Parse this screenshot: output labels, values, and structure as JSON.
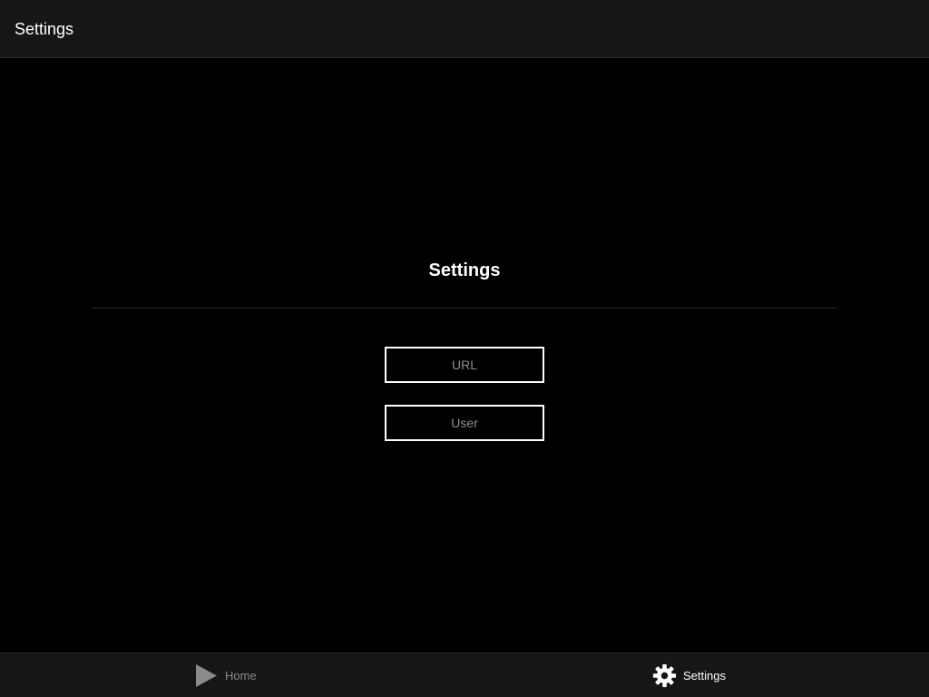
{
  "nav": {
    "title": "Settings"
  },
  "main": {
    "section_title": "Settings",
    "url_field": {
      "placeholder": "URL",
      "value": ""
    },
    "user_field": {
      "placeholder": "User",
      "value": ""
    }
  },
  "tab_bar": {
    "tabs": [
      {
        "label": "Home",
        "icon": "play-icon",
        "selected": false,
        "color": "#8a8a8a"
      },
      {
        "label": "Settings",
        "icon": "gear-icon",
        "selected": true,
        "color": "#ffffff"
      }
    ]
  },
  "colors": {
    "background": "#000000",
    "bar_background": "#161616",
    "accent": "#ffffff",
    "inactive": "#8a8a8a"
  }
}
